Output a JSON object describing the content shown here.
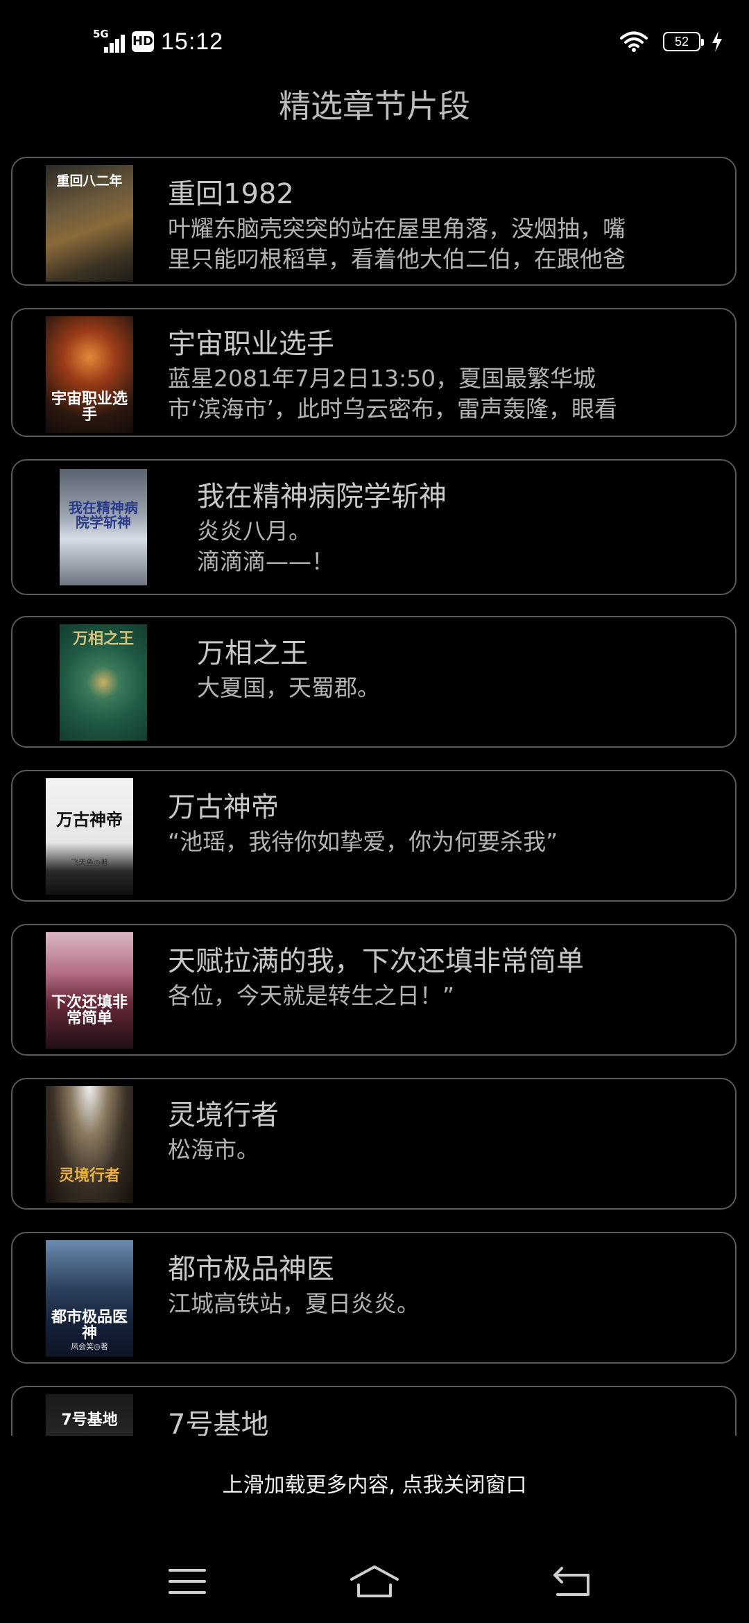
{
  "status_bar": {
    "network": "5G",
    "hd": "HD",
    "time": "15:12",
    "battery": "52"
  },
  "title": "精选章节片段",
  "books": [
    {
      "title": "重回1982",
      "snippet": "叶耀东脑壳突突的站在屋里角落，没烟抽，嘴\n里只能叼根稻草，看着他大伯二伯，在跟他爸",
      "cover_text": "重回八二年"
    },
    {
      "title": "宇宙职业选手",
      "snippet": "蓝星2081年7月2日13:50，夏国最繁华城\n市‘滨海市’，此时乌云密布，雷声轰隆，眼看",
      "cover_text": "宇宙职业选手"
    },
    {
      "title": "我在精神病院学斩神",
      "snippet": "炎炎八月。\n滴滴滴——！",
      "cover_text": "我在精神病院学斩神"
    },
    {
      "title": "万相之王",
      "snippet": "大夏国，天蜀郡。",
      "cover_text": "万相之王"
    },
    {
      "title": "万古神帝",
      "snippet": "“池瑶，我待你如挚爱，你为何要杀我”",
      "cover_text": "万古神帝",
      "cover_author": "飞天鱼◎著"
    },
    {
      "title": "天赋拉满的我，下次还填非常简单",
      "snippet": "各位，今天就是转生之日！”",
      "cover_text": "下次还填非常简单"
    },
    {
      "title": "灵境行者",
      "snippet": "松海市。",
      "cover_text": "灵境行者"
    },
    {
      "title": "都市极品神医",
      "snippet": "江城高铁站，夏日炎炎。",
      "cover_text": "都市极品医神",
      "cover_author": "风会笑◎著"
    },
    {
      "title": "7号基地",
      "snippet": "",
      "cover_text": "7号基地"
    }
  ],
  "load_more": "上滑加载更多内容, 点我关闭窗口",
  "nav": {
    "menu": "menu-icon",
    "home": "home-icon",
    "back": "back-icon"
  }
}
